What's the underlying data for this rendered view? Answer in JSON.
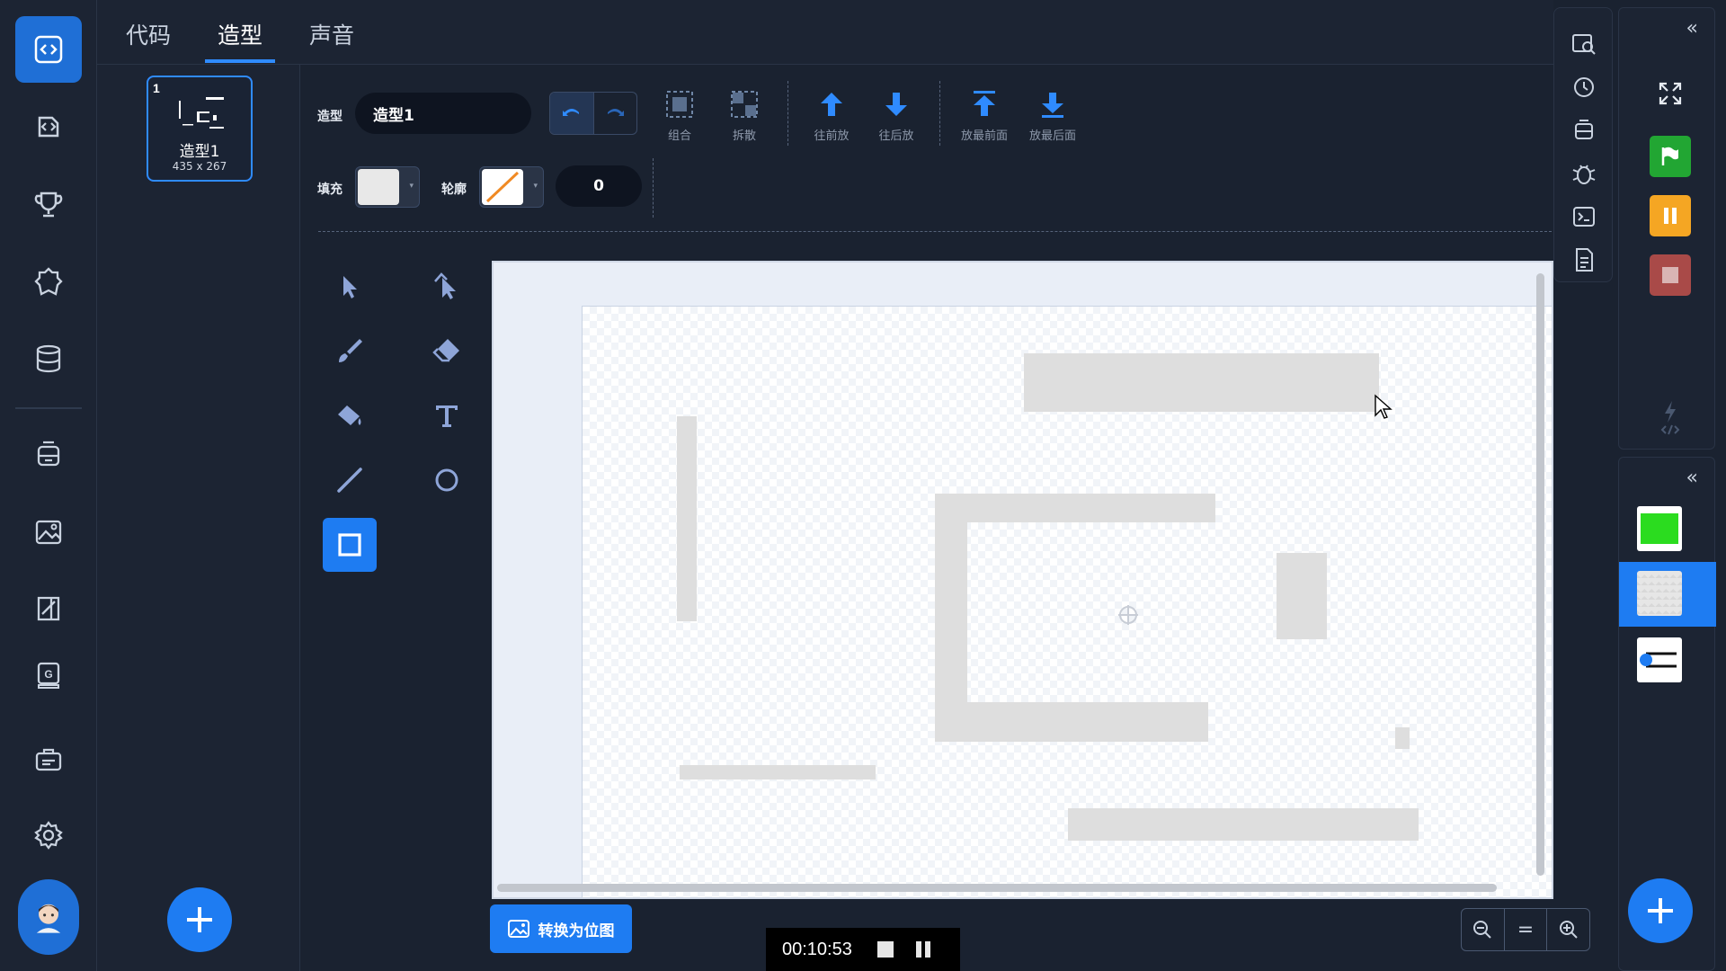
{
  "tabs": [
    {
      "label": "代码"
    },
    {
      "label": "造型"
    },
    {
      "label": "声音"
    }
  ],
  "costume": {
    "index": "1",
    "name": "造型1",
    "size": "435 x 267"
  },
  "toolbar": {
    "costume_label": "造型",
    "costume_name": "造型1",
    "group_label": "组合",
    "ungroup_label": "拆散",
    "forward_label": "往前放",
    "backward_label": "往后放",
    "front_label": "放最前面",
    "back_label": "放最后面",
    "fill_label": "填充",
    "outline_label": "轮廓",
    "outline_width": "0",
    "fill_color": "#e8e8e8",
    "outline_color": "none"
  },
  "canvas": {
    "convert_label": "转换为位图",
    "zoom_reset_label": "="
  },
  "recorder": {
    "time": "00:10:53"
  },
  "colors": {
    "accent": "#1e7cf2",
    "run_green": "#22a633",
    "pause_orange": "#f5a623",
    "stop_red": "#c0504d",
    "sprite_green": "#2bdc1f"
  },
  "icons": {
    "nav": [
      "code-editor-icon",
      "import-icon",
      "trophy-icon",
      "badge-icon",
      "database-icon",
      "robot-icon",
      "image-icon",
      "book-edit-icon",
      "g-book-icon",
      "briefcase-icon",
      "settings-icon",
      "user-avatar-icon"
    ],
    "float_tools": [
      "find-icon",
      "history-icon",
      "robot-icon",
      "debug-icon",
      "terminal-icon",
      "document-icon"
    ]
  }
}
